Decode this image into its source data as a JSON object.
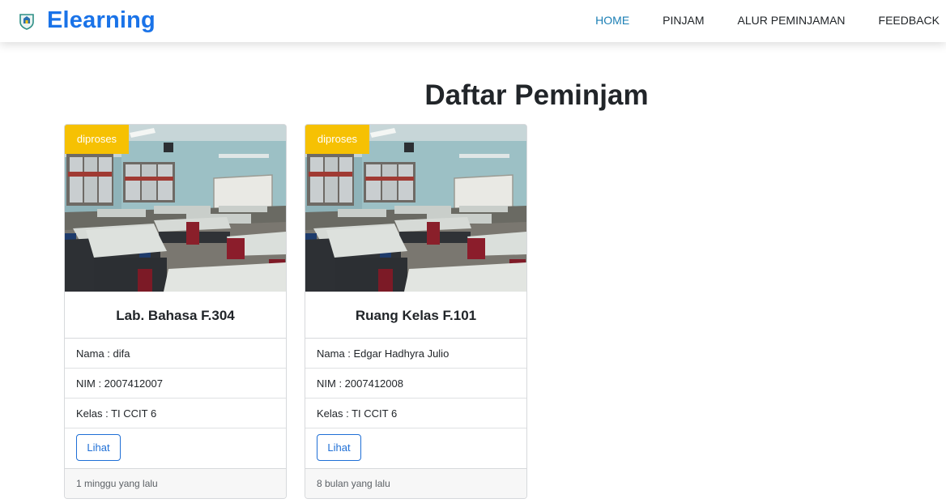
{
  "navbar": {
    "brand": "Elearning",
    "brand_icon": "school-logo-icon",
    "items": [
      {
        "label": "HOME",
        "active": true
      },
      {
        "label": "PINJAM",
        "active": false
      },
      {
        "label": "ALUR PEMINJAMAN",
        "active": false
      },
      {
        "label": "FEEDBACK",
        "active": false
      }
    ]
  },
  "main": {
    "title": "Daftar Peminjam",
    "cards": [
      {
        "status": "diproses",
        "room": "Lab. Bahasa F.304",
        "nama": "Nama : difa",
        "nim": "NIM : 2007412007",
        "kelas": "Kelas : TI CCIT 6",
        "button": "Lihat",
        "time": "1 minggu yang lalu"
      },
      {
        "status": "diproses",
        "room": "Ruang Kelas F.101",
        "nama": "Nama : Edgar Hadhyra Julio",
        "nim": "NIM : 2007412008",
        "kelas": "Kelas : TI CCIT 6",
        "button": "Lihat",
        "time": "8 bulan yang lalu"
      }
    ]
  },
  "colors": {
    "brand": "#1a73e8",
    "nav_active": "#1b7fb5",
    "badge": "#f6c103",
    "button_outline": "#1f6fd6"
  }
}
